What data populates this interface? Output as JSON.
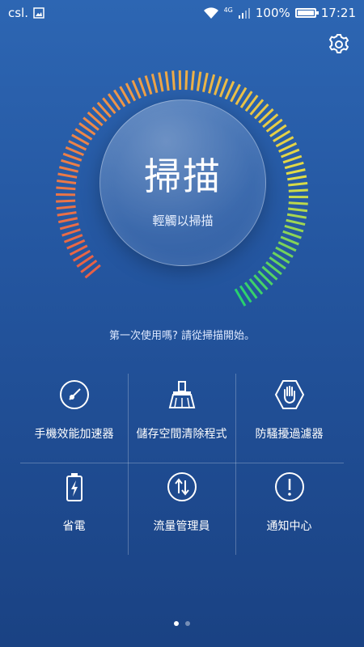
{
  "status": {
    "carrier": "csl.",
    "network": "4G",
    "battery": "100%",
    "battery_level": 1.0,
    "time": "17:21"
  },
  "scan": {
    "title": "掃描",
    "subtitle": "輕觸以掃描"
  },
  "hint": "第一次使用嗎? 請從掃描開始。",
  "tiles": [
    {
      "label": "手機效能加速器",
      "icon": "gauge-icon"
    },
    {
      "label": "儲存空間清除程式",
      "icon": "broom-icon"
    },
    {
      "label": "防騷擾過濾器",
      "icon": "hand-shield-icon"
    },
    {
      "label": "省電",
      "icon": "battery-icon"
    },
    {
      "label": "流量管理員",
      "icon": "data-arrows-icon"
    },
    {
      "label": "通知中心",
      "icon": "exclamation-icon"
    }
  ],
  "pager": {
    "count": 2,
    "active": 0
  }
}
